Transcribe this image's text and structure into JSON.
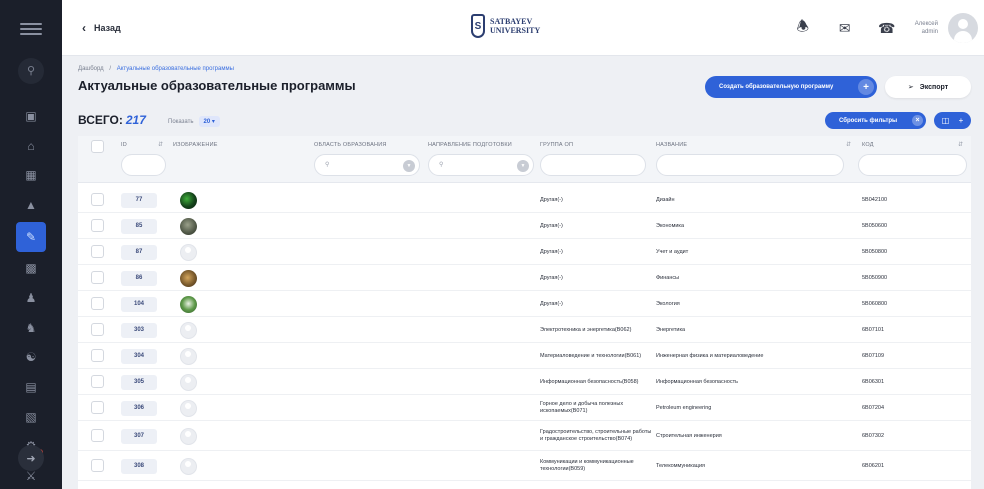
{
  "header": {
    "back_label": "Назад",
    "logo_line1": "SATBAYEV",
    "logo_line2": "UNIVERSITY",
    "logo_mark": "S",
    "user_name": "Алексей",
    "user_role": "admin"
  },
  "breadcrumb": {
    "home": "Дашборд",
    "sep": "/",
    "current": "Актуальные образовательные программы"
  },
  "page": {
    "title": "Актуальные образовательные программы",
    "create_label": "Создать образовательную программу",
    "export_label": "Экспорт",
    "total_label": "ВСЕГО:",
    "total_count": "217",
    "show_label": "Показать",
    "show_value": "20 ▾",
    "reset_label": "Сбросить фильтры"
  },
  "columns": {
    "id": "ID",
    "image": "ИЗОБРАЖЕНИЕ",
    "area": "ОБЛАСТЬ ОБРАЗОВАНИЯ",
    "direction": "НАПРАВЛЕНИЕ ПОДГОТОВКИ",
    "group": "ГРУППА ОП",
    "name": "НАЗВАНИЕ",
    "code": "КОД"
  },
  "rows": [
    {
      "id": "77",
      "img": "photo-green",
      "group": "Другая(-)",
      "name": "Дизайн",
      "code": "5В042100"
    },
    {
      "id": "85",
      "img": "photo-gray",
      "group": "Другая(-)",
      "name": "Экономика",
      "code": "5В050600"
    },
    {
      "id": "87",
      "img": "placeholder",
      "group": "Другая(-)",
      "name": "Учет и аудит",
      "code": "5В050800"
    },
    {
      "id": "86",
      "img": "photo-brown",
      "group": "Другая(-)",
      "name": "Финансы",
      "code": "5В050900"
    },
    {
      "id": "104",
      "img": "photo-leaf",
      "group": "Другая(-)",
      "name": "Экология",
      "code": "5В060800"
    },
    {
      "id": "303",
      "img": "placeholder",
      "group": "Электротехника и энергетика(В062)",
      "name": "Энергетика",
      "code": "6В07101"
    },
    {
      "id": "304",
      "img": "placeholder",
      "group": "Материаловедение и технологии(В061)",
      "name": "Инженерная физика и материаловедение",
      "code": "6В07109"
    },
    {
      "id": "305",
      "img": "placeholder",
      "group": "Информационная безопасность(В058)",
      "name": "Информационная безопасность",
      "code": "6В06301"
    },
    {
      "id": "306",
      "img": "placeholder",
      "group": "Горное дело и добыча полезных ископаемых(В071)",
      "name": "Petroleum engineering",
      "code": "6В07204"
    },
    {
      "id": "307",
      "img": "placeholder",
      "group": "Градостроительство, строительные работы и гражданское строительство(В074)",
      "name": "Строительная инженерия",
      "code": "6В07302"
    },
    {
      "id": "308",
      "img": "placeholder",
      "group": "Коммуникации и коммуникационные технологии(В059)",
      "name": "Телекоммуникация",
      "code": "6В06201"
    }
  ]
}
